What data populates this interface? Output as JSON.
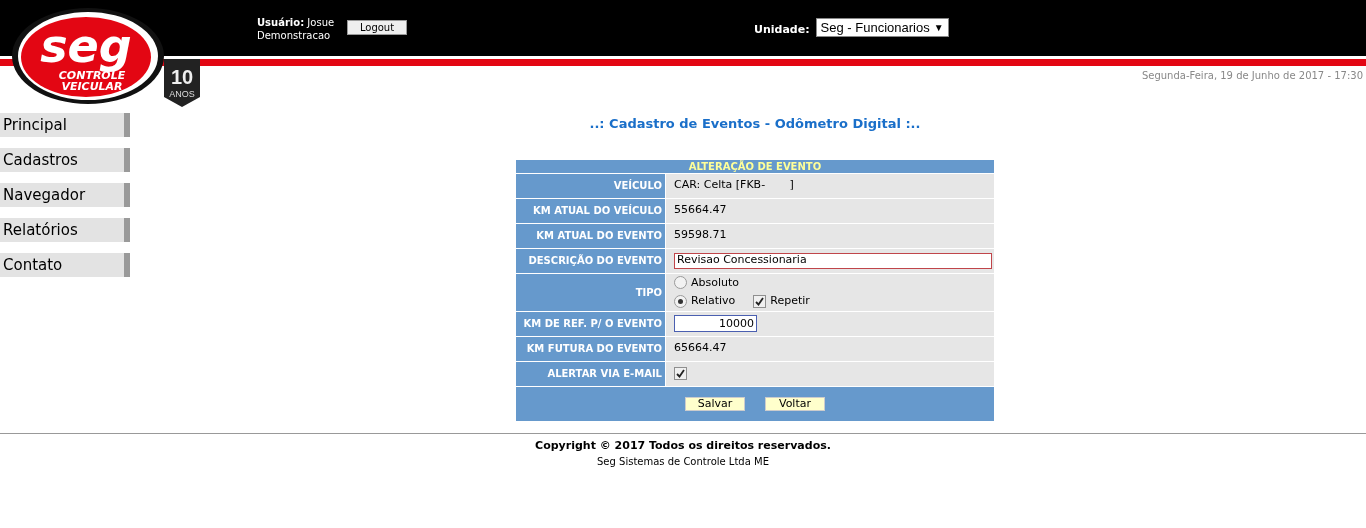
{
  "logo": {
    "brand": "seg",
    "line1": "CONTROLE",
    "line2": "VEICULAR",
    "badge_number": "10",
    "badge_word": "ANOS"
  },
  "header": {
    "user_label": "Usuário:",
    "user_name": "Josue Demonstracao",
    "logout": "Logout",
    "unit_label": "Unidade:",
    "unit_value": "Seg - Funcionarios",
    "unit_caret": "▼"
  },
  "date": "Segunda-Feira, 19 de Junho de 2017 - 17:30",
  "sidebar": {
    "items": [
      {
        "label": "Principal"
      },
      {
        "label": "Cadastros"
      },
      {
        "label": "Navegador"
      },
      {
        "label": "Relatórios"
      },
      {
        "label": "Contato"
      }
    ]
  },
  "page_title": "..: Cadastro de Eventos - Odômetro Digital :..",
  "form": {
    "title": "ALTERAÇÃO DE EVENTO",
    "rows": [
      {
        "kind": "text",
        "label": "VEÍCULO",
        "value": "CAR: Celta [FKB-       ]"
      },
      {
        "kind": "text",
        "label": "KM ATUAL DO VEÍCULO",
        "value": "55664.47"
      },
      {
        "kind": "text",
        "label": "KM ATUAL DO EVENTO",
        "value": "59598.71"
      },
      {
        "kind": "input",
        "label": "DESCRIÇÃO DO EVENTO",
        "value": "Revisao Concessionaria"
      },
      {
        "kind": "tipo",
        "label": "TIPO",
        "options": [
          {
            "label": "Absoluto",
            "selected": false
          },
          {
            "label": "Relativo",
            "selected": true
          }
        ],
        "repeat": {
          "label": "Repetir",
          "checked": true
        }
      },
      {
        "kind": "number",
        "label": "KM DE REF. P/ O EVENTO",
        "value": "10000"
      },
      {
        "kind": "text",
        "label": "KM FUTURA DO EVENTO",
        "value": "65664.47"
      },
      {
        "kind": "checkbox",
        "label": "ALERTAR VIA E-MAIL",
        "checked": true
      }
    ],
    "buttons": [
      "Salvar",
      "Voltar"
    ]
  },
  "footer": {
    "copyright": "Copyright © 2017 Todos os direitos reservados.",
    "company": "Seg Sistemas de Controle Ltda ME"
  }
}
